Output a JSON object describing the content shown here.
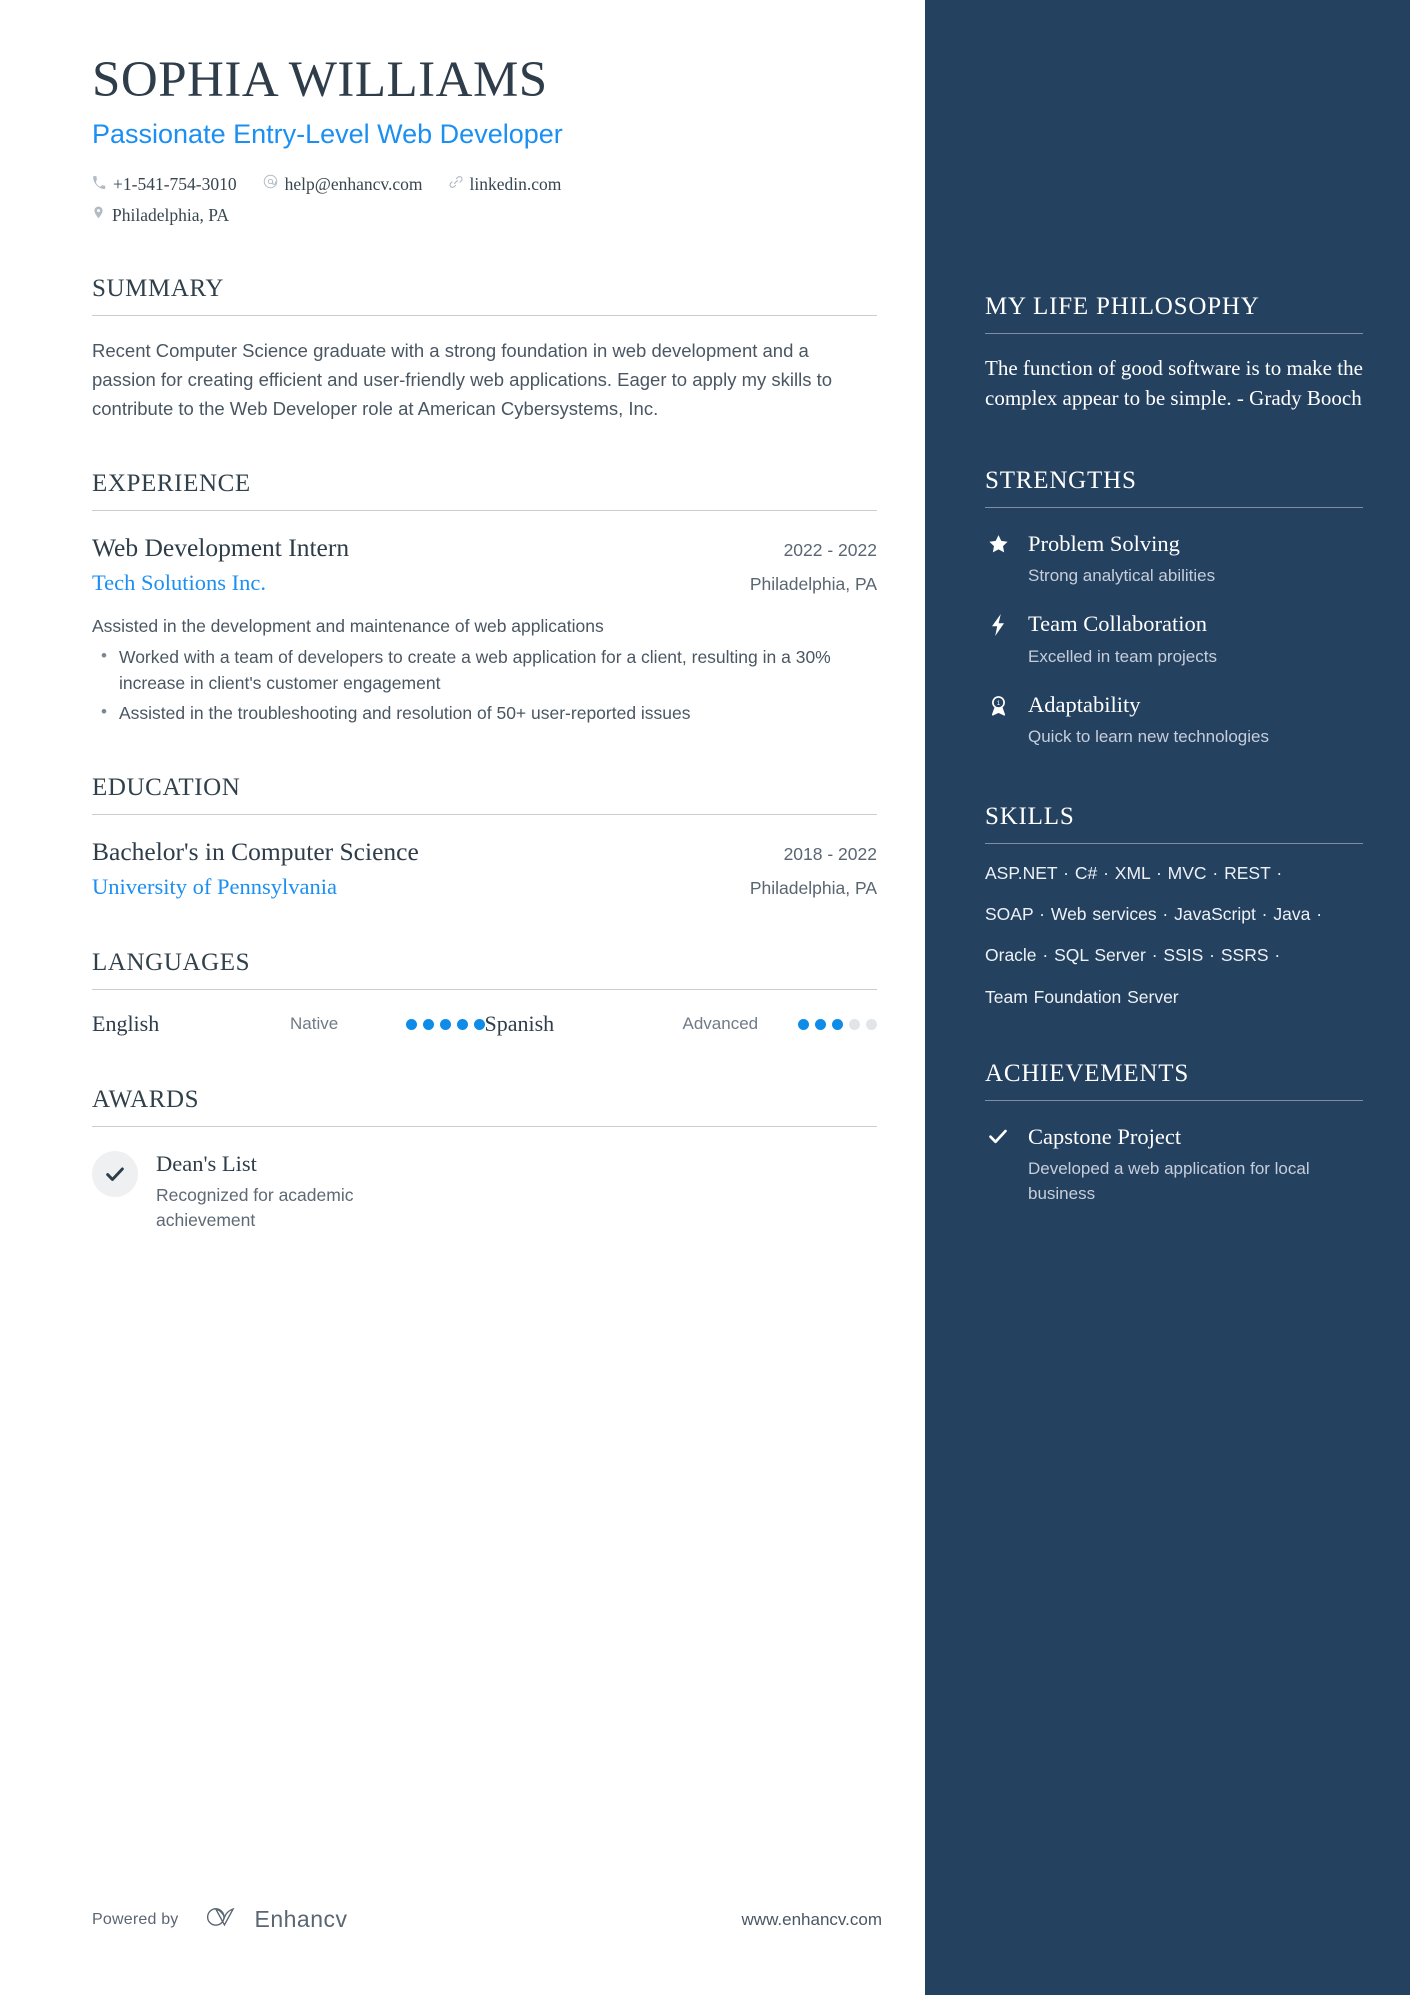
{
  "header": {
    "name": "SOPHIA WILLIAMS",
    "role": "Passionate Entry-Level Web Developer",
    "contacts": [
      {
        "icon": "phone-icon",
        "text": "+1-541-754-3010"
      },
      {
        "icon": "email-icon",
        "text": "help@enhancv.com"
      },
      {
        "icon": "link-icon",
        "text": "linkedin.com"
      },
      {
        "icon": "location-icon",
        "text": "Philadelphia, PA"
      }
    ]
  },
  "summary": {
    "title": "SUMMARY",
    "text": "Recent Computer Science graduate with a strong foundation in web development and a passion for creating efficient and user-friendly web applications. Eager to apply my skills to contribute to the Web Developer role at American Cybersystems, Inc."
  },
  "experience": {
    "title": "EXPERIENCE",
    "entries": [
      {
        "position": "Web Development Intern",
        "company": "Tech Solutions Inc.",
        "dates": "2022 - 2022",
        "location": "Philadelphia, PA",
        "description": "Assisted in the development and maintenance of web applications",
        "bullets": [
          "Worked with a team of developers to create a web application for a client, resulting in a 30% increase in client's customer engagement",
          "Assisted in the troubleshooting and resolution of 50+ user-reported issues"
        ]
      }
    ]
  },
  "education": {
    "title": "EDUCATION",
    "entries": [
      {
        "degree": "Bachelor's in Computer Science",
        "school": "University of Pennsylvania",
        "dates": "2018 - 2022",
        "location": "Philadelphia, PA"
      }
    ]
  },
  "languages": {
    "title": "LANGUAGES",
    "items": [
      {
        "name": "English",
        "level": "Native",
        "filled": 5,
        "total": 5
      },
      {
        "name": "Spanish",
        "level": "Advanced",
        "filled": 3,
        "total": 5
      }
    ]
  },
  "awards": {
    "title": "AWARDS",
    "items": [
      {
        "icon": "check-icon",
        "name": "Dean's List",
        "description": "Recognized for academic achievement"
      }
    ]
  },
  "philosophy": {
    "title": "MY LIFE PHILOSOPHY",
    "quote": "The function of good software is to make the complex appear to be simple. - Grady Booch"
  },
  "strengths": {
    "title": "STRENGTHS",
    "items": [
      {
        "icon": "star-icon",
        "name": "Problem Solving",
        "description": "Strong analytical abilities"
      },
      {
        "icon": "bolt-icon",
        "name": "Team Collaboration",
        "description": "Excelled in team projects"
      },
      {
        "icon": "award-ribbon-icon",
        "name": "Adaptability",
        "description": "Quick to learn new technologies"
      }
    ]
  },
  "skills": {
    "title": "SKILLS",
    "lines": [
      "ASP.NET · C# · XML · MVC · REST ·",
      "SOAP · Web services · JavaScript · Java ·",
      "Oracle · SQL Server · SSIS · SSRS ·",
      "Team Foundation Server"
    ]
  },
  "achievements": {
    "title": "ACHIEVEMENTS",
    "items": [
      {
        "icon": "check-icon",
        "name": "Capstone Project",
        "description": "Developed a web application for local business"
      }
    ]
  },
  "footer": {
    "powered_by": "Powered by",
    "brand": "Enhancv",
    "site": "www.enhancv.com"
  },
  "colors": {
    "sidebar_bg": "#24415f",
    "accent_blue": "#1c8ff2",
    "heading": "#2e3d49",
    "body_text": "#4a5763"
  }
}
